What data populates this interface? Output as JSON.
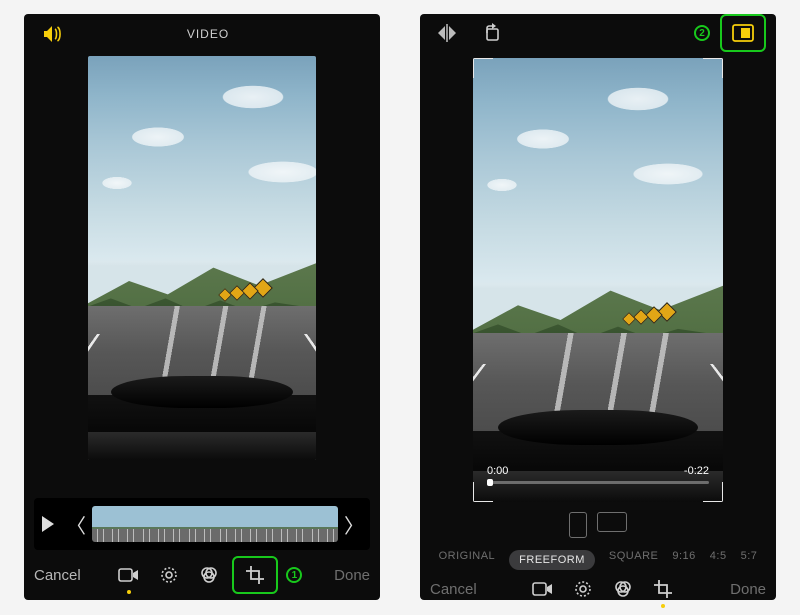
{
  "colors": {
    "accent": "#18c91c",
    "yellow": "#f6ce0b"
  },
  "left": {
    "header_title": "VIDEO",
    "volume_icon": "volume-icon",
    "timeline": {
      "play_icon": "play-icon",
      "handle_left": "〈",
      "handle_right": "〉",
      "frame_count": 16
    },
    "bottom": {
      "cancel": "Cancel",
      "done": "Done",
      "tools": [
        {
          "name": "video-tool-icon",
          "active_dot": true
        },
        {
          "name": "adjust-tool-icon",
          "active_dot": false
        },
        {
          "name": "filters-tool-icon",
          "active_dot": false
        },
        {
          "name": "crop-tool-icon",
          "active_dot": false
        }
      ],
      "step_badge": "1"
    }
  },
  "right": {
    "top_icons": {
      "flip": "flip-horizontal-icon",
      "rotate": "rotate-icon",
      "aspect": "aspect-ratio-icon"
    },
    "step_badge": "2",
    "scrubber": {
      "start": "0:00",
      "end": "-0:22"
    },
    "orientation": {
      "portrait": "portrait",
      "landscape": "landscape"
    },
    "aspect_options": [
      "ORIGINAL",
      "FREEFORM",
      "SQUARE",
      "9:16",
      "4:5",
      "5:7"
    ],
    "aspect_selected": "FREEFORM",
    "bottom": {
      "cancel": "Cancel",
      "done": "Done",
      "tools": [
        {
          "name": "video-tool-icon",
          "active_dot": false
        },
        {
          "name": "adjust-tool-icon",
          "active_dot": false
        },
        {
          "name": "filters-tool-icon",
          "active_dot": false
        },
        {
          "name": "crop-tool-icon",
          "active_dot": true
        }
      ]
    }
  }
}
